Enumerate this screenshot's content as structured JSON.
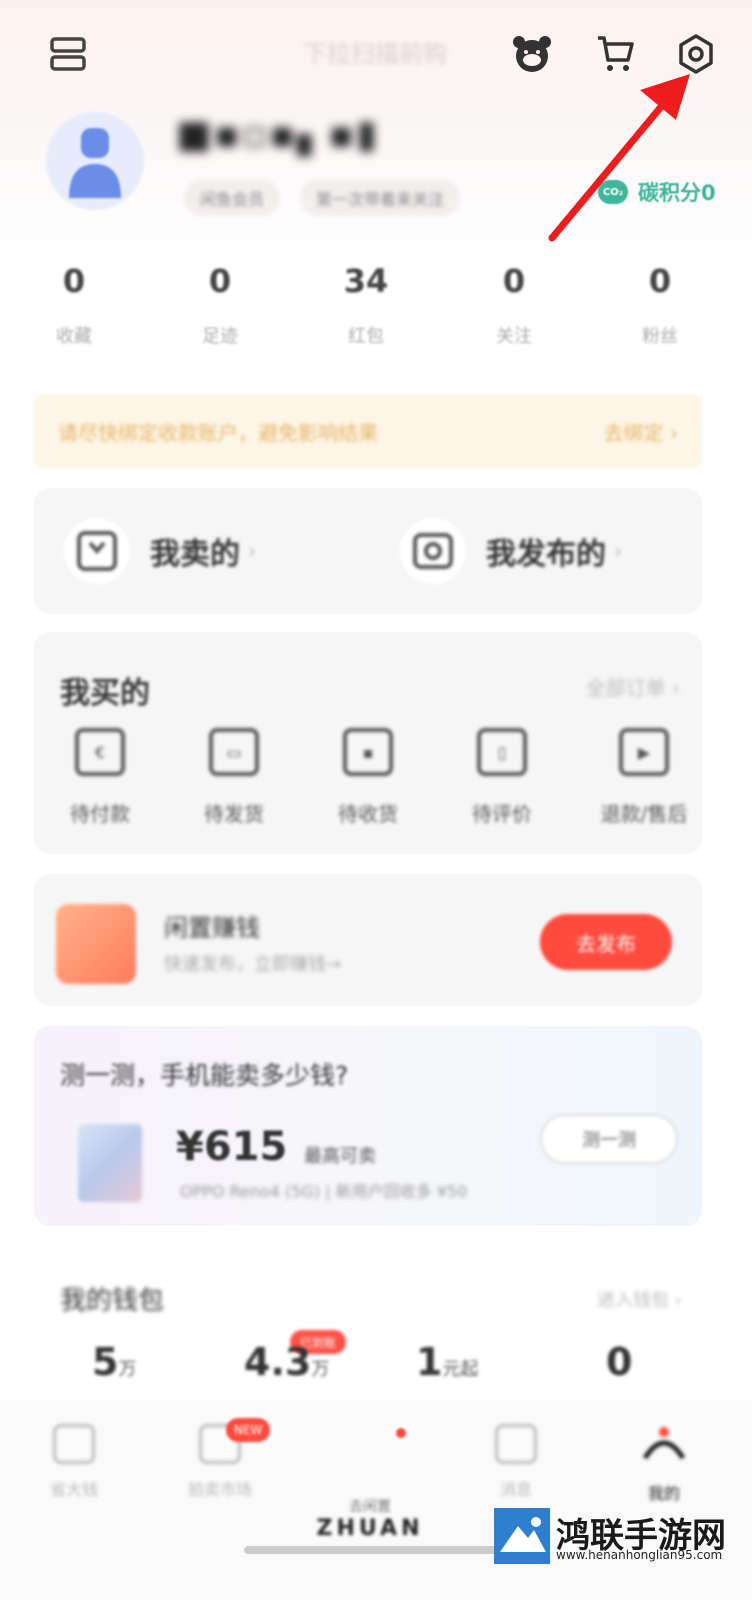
{
  "topbar": {
    "title": "下拉扫描前购",
    "icons": [
      "menu-icon",
      "bear-service-icon",
      "cart-icon",
      "settings-icon"
    ]
  },
  "profile": {
    "username": "■▪▫▪▖▪▮",
    "chip_1": "闲鱼会员",
    "chip_2": "第一次带着来关注",
    "carbon_label": "碳积分0",
    "carbon_badge": "CO₂"
  },
  "stats": [
    {
      "value": "0",
      "label": "收藏"
    },
    {
      "value": "0",
      "label": "足迹"
    },
    {
      "value": "34",
      "label": "红包"
    },
    {
      "value": "0",
      "label": "关注"
    },
    {
      "value": "0",
      "label": "粉丝"
    }
  ],
  "banner": {
    "text": "请尽快绑定收款账户，避免影响结果",
    "link": "去绑定 ›"
  },
  "sell": {
    "sold_label": "我卖的",
    "published_label": "我发布的"
  },
  "bought": {
    "title": "我买的",
    "more": "全部订单 ›",
    "items": [
      {
        "label": "待付款",
        "glyph": "€"
      },
      {
        "label": "待发货",
        "glyph": "▭"
      },
      {
        "label": "待收货",
        "glyph": "▪"
      },
      {
        "label": "待评价",
        "glyph": "▯"
      },
      {
        "label": "退款/售后",
        "glyph": "▶"
      }
    ]
  },
  "idle": {
    "title": "闲置赚钱",
    "subtitle": "快速发布，立即赚钱→",
    "button": "去发布"
  },
  "estimate": {
    "title": "测一测，手机能卖多少钱?",
    "price": "¥615",
    "price_note": "最高可卖",
    "model": "OPPO Reno4 (5G) | 新用户回收多 ¥50",
    "button": "测一测"
  },
  "wallet": {
    "title": "我的钱包",
    "more": "进入钱包 ›",
    "tag": "已到账",
    "values": [
      {
        "value": "5",
        "unit": "万"
      },
      {
        "value": "4.3",
        "unit": "万"
      },
      {
        "value": "1",
        "unit": "元起"
      },
      {
        "value": "0",
        "unit": ""
      }
    ]
  },
  "bottom_nav": {
    "items": [
      {
        "label": "省大钱"
      },
      {
        "label": "拍卖市场"
      },
      {
        "label": "消息"
      },
      {
        "label": "我的"
      }
    ],
    "badge": "NEW",
    "center_top": "去闲置",
    "center_big": "ZHUAN"
  },
  "watermark": {
    "title": "鸿联手游网",
    "url": "www.henanhonglian95.com"
  },
  "colors": {
    "accent": "#ff4b3e",
    "carbon": "#3fb59a",
    "arrow": "#ee1c1c",
    "banner_bg": "#fdf5e6"
  }
}
